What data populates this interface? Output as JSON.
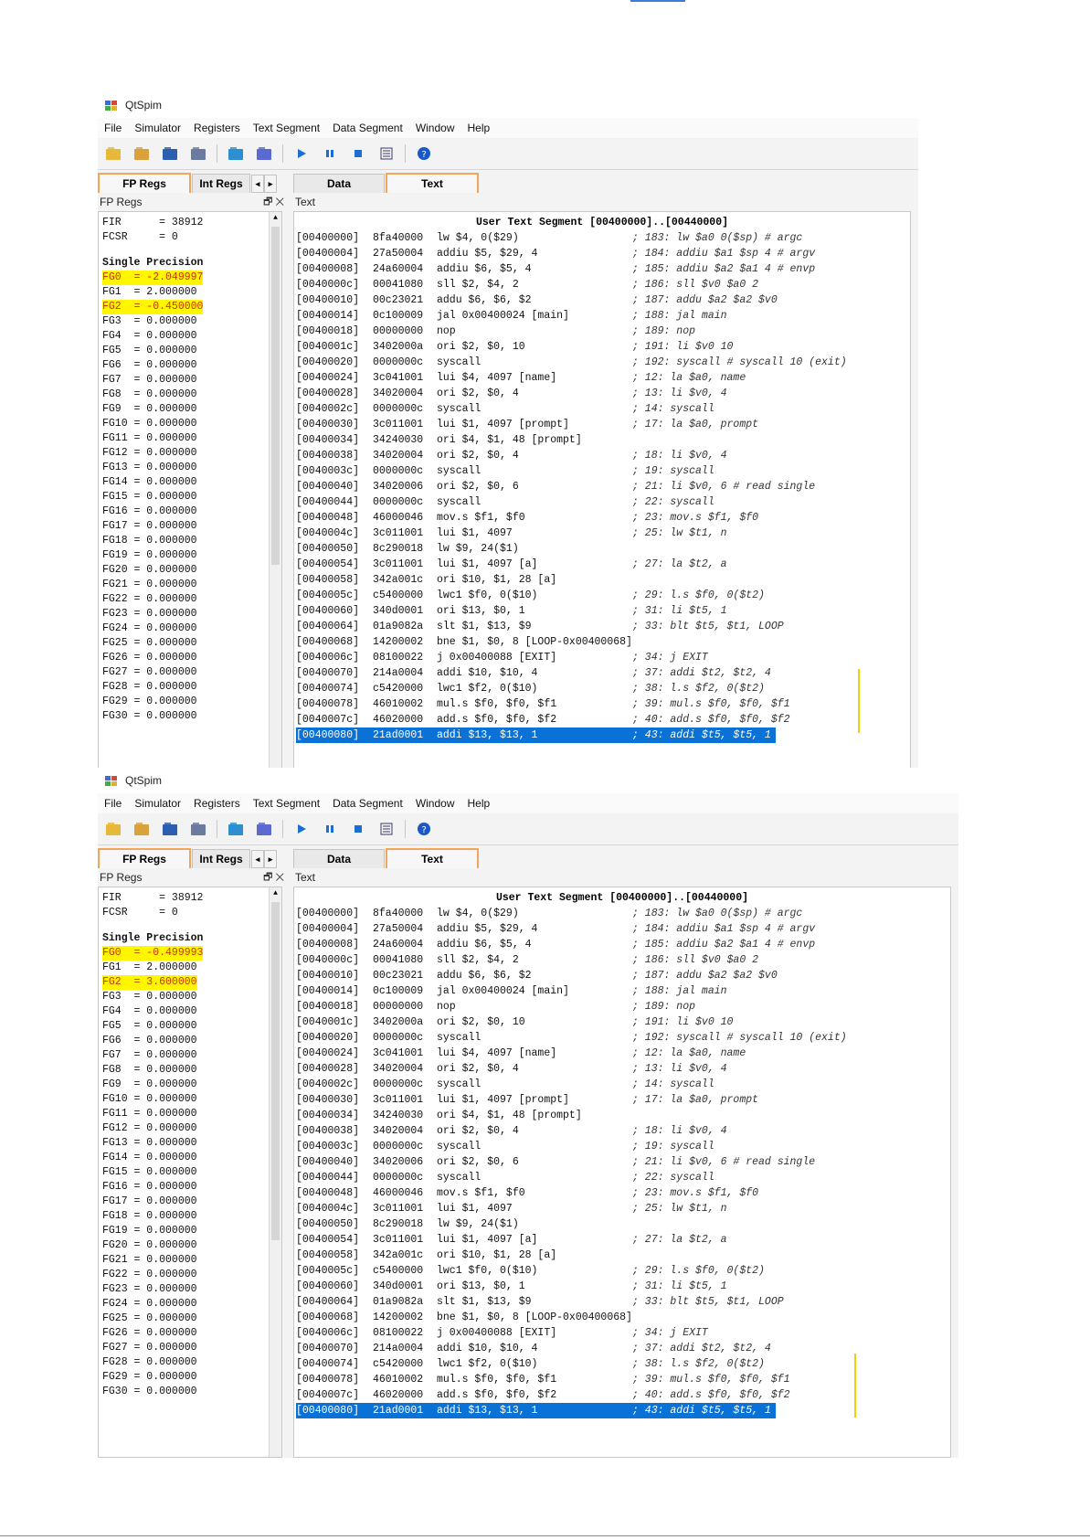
{
  "windows": [
    {
      "app_title": "QtSpim",
      "menu": [
        "File",
        "Simulator",
        "Registers",
        "Text Segment",
        "Data Segment",
        "Window",
        "Help"
      ],
      "left_tabs": [
        "FP Regs",
        "Int Regs"
      ],
      "right_tabs": [
        "Data",
        "Text"
      ],
      "left_dock_title": "FP Regs",
      "right_dock_title": "Text",
      "fir": "FIR      = 38912",
      "fcsr": "FCSR     = 0",
      "single_header": "Single Precision",
      "regs": [
        "FG0  = -2.049997",
        "FG1  = 2.000000",
        "FG2  = -0.450000",
        "FG3  = 0.000000",
        "FG4  = 0.000000",
        "FG5  = 0.000000",
        "FG6  = 0.000000",
        "FG7  = 0.000000",
        "FG8  = 0.000000",
        "FG9  = 0.000000",
        "FG10 = 0.000000",
        "FG11 = 0.000000",
        "FG12 = 0.000000",
        "FG13 = 0.000000",
        "FG14 = 0.000000",
        "FG15 = 0.000000",
        "FG16 = 0.000000",
        "FG17 = 0.000000",
        "FG18 = 0.000000",
        "FG19 = 0.000000",
        "FG20 = 0.000000",
        "FG21 = 0.000000",
        "FG22 = 0.000000",
        "FG23 = 0.000000",
        "FG24 = 0.000000",
        "FG25 = 0.000000",
        "FG26 = 0.000000",
        "FG27 = 0.000000",
        "FG28 = 0.000000",
        "FG29 = 0.000000",
        "FG30 = 0.000000"
      ],
      "highlighted_regs": [
        0,
        2
      ]
    },
    {
      "app_title": "QtSpim",
      "menu": [
        "File",
        "Simulator",
        "Registers",
        "Text Segment",
        "Data Segment",
        "Window",
        "Help"
      ],
      "left_tabs": [
        "FP Regs",
        "Int Regs"
      ],
      "right_tabs": [
        "Data",
        "Text"
      ],
      "left_dock_title": "FP Regs",
      "right_dock_title": "Text",
      "fir": "FIR      = 38912",
      "fcsr": "FCSR     = 0",
      "single_header": "Single Precision",
      "regs": [
        "FG0  = -0.499993",
        "FG1  = 2.000000",
        "FG2  = 3.600000",
        "FG3  = 0.000000",
        "FG4  = 0.000000",
        "FG5  = 0.000000",
        "FG6  = 0.000000",
        "FG7  = 0.000000",
        "FG8  = 0.000000",
        "FG9  = 0.000000",
        "FG10 = 0.000000",
        "FG11 = 0.000000",
        "FG12 = 0.000000",
        "FG13 = 0.000000",
        "FG14 = 0.000000",
        "FG15 = 0.000000",
        "FG16 = 0.000000",
        "FG17 = 0.000000",
        "FG18 = 0.000000",
        "FG19 = 0.000000",
        "FG20 = 0.000000",
        "FG21 = 0.000000",
        "FG22 = 0.000000",
        "FG23 = 0.000000",
        "FG24 = 0.000000",
        "FG25 = 0.000000",
        "FG26 = 0.000000",
        "FG27 = 0.000000",
        "FG28 = 0.000000",
        "FG29 = 0.000000",
        "FG30 = 0.000000"
      ],
      "highlighted_regs": [
        0,
        2
      ]
    }
  ],
  "segment_header": "User Text Segment [00400000]..[00440000]",
  "code": [
    {
      "addr": "[00400000]",
      "hex": "8fa40000",
      "ins": "lw $4, 0($29)",
      "cmt": "; 183: lw $a0 0($sp) # argc"
    },
    {
      "addr": "[00400004]",
      "hex": "27a50004",
      "ins": "addiu $5, $29, 4",
      "cmt": "; 184: addiu $a1 $sp 4 # argv"
    },
    {
      "addr": "[00400008]",
      "hex": "24a60004",
      "ins": "addiu $6, $5, 4",
      "cmt": "; 185: addiu $a2 $a1 4 # envp"
    },
    {
      "addr": "[0040000c]",
      "hex": "00041080",
      "ins": "sll $2, $4, 2",
      "cmt": "; 186: sll $v0 $a0 2"
    },
    {
      "addr": "[00400010]",
      "hex": "00c23021",
      "ins": "addu $6, $6, $2",
      "cmt": "; 187: addu $a2 $a2 $v0"
    },
    {
      "addr": "[00400014]",
      "hex": "0c100009",
      "ins": "jal 0x00400024 [main]",
      "cmt": "; 188: jal main"
    },
    {
      "addr": "[00400018]",
      "hex": "00000000",
      "ins": "nop",
      "cmt": "; 189: nop"
    },
    {
      "addr": "[0040001c]",
      "hex": "3402000a",
      "ins": "ori $2, $0, 10",
      "cmt": "; 191: li $v0 10"
    },
    {
      "addr": "[00400020]",
      "hex": "0000000c",
      "ins": "syscall",
      "cmt": "; 192: syscall # syscall 10 (exit)"
    },
    {
      "addr": "[00400024]",
      "hex": "3c041001",
      "ins": "lui $4, 4097 [name]",
      "cmt": "; 12: la $a0, name"
    },
    {
      "addr": "[00400028]",
      "hex": "34020004",
      "ins": "ori $2, $0, 4",
      "cmt": "; 13: li $v0, 4"
    },
    {
      "addr": "[0040002c]",
      "hex": "0000000c",
      "ins": "syscall",
      "cmt": "; 14: syscall"
    },
    {
      "addr": "[00400030]",
      "hex": "3c011001",
      "ins": "lui $1, 4097 [prompt]",
      "cmt": "; 17: la $a0, prompt"
    },
    {
      "addr": "[00400034]",
      "hex": "34240030",
      "ins": "ori $4, $1, 48 [prompt]",
      "cmt": ""
    },
    {
      "addr": "[00400038]",
      "hex": "34020004",
      "ins": "ori $2, $0, 4",
      "cmt": "; 18: li $v0, 4"
    },
    {
      "addr": "[0040003c]",
      "hex": "0000000c",
      "ins": "syscall",
      "cmt": "; 19: syscall"
    },
    {
      "addr": "[00400040]",
      "hex": "34020006",
      "ins": "ori $2, $0, 6",
      "cmt": "; 21: li $v0, 6 # read single"
    },
    {
      "addr": "[00400044]",
      "hex": "0000000c",
      "ins": "syscall",
      "cmt": "; 22: syscall"
    },
    {
      "addr": "[00400048]",
      "hex": "46000046",
      "ins": "mov.s $f1, $f0",
      "cmt": "; 23: mov.s $f1, $f0"
    },
    {
      "addr": "[0040004c]",
      "hex": "3c011001",
      "ins": "lui $1, 4097",
      "cmt": "; 25: lw $t1, n"
    },
    {
      "addr": "[00400050]",
      "hex": "8c290018",
      "ins": "lw $9, 24($1)",
      "cmt": ""
    },
    {
      "addr": "[00400054]",
      "hex": "3c011001",
      "ins": "lui $1, 4097 [a]",
      "cmt": "; 27: la $t2, a"
    },
    {
      "addr": "[00400058]",
      "hex": "342a001c",
      "ins": "ori $10, $1, 28 [a]",
      "cmt": ""
    },
    {
      "addr": "[0040005c]",
      "hex": "c5400000",
      "ins": "lwc1 $f0, 0($10)",
      "cmt": "; 29: l.s $f0, 0($t2)"
    },
    {
      "addr": "[00400060]",
      "hex": "340d0001",
      "ins": "ori $13, $0, 1",
      "cmt": "; 31: li $t5, 1"
    },
    {
      "addr": "[00400064]",
      "hex": "01a9082a",
      "ins": "slt $1, $13, $9",
      "cmt": "; 33: blt $t5, $t1, LOOP"
    },
    {
      "addr": "[00400068]",
      "hex": "14200002",
      "ins": "bne $1, $0, 8 [LOOP-0x00400068]",
      "cmt": ""
    },
    {
      "addr": "[0040006c]",
      "hex": "08100022",
      "ins": "j 0x00400088 [EXIT]",
      "cmt": "; 34: j EXIT"
    },
    {
      "addr": "[00400070]",
      "hex": "214a0004",
      "ins": "addi $10, $10, 4",
      "cmt": "; 37: addi $t2, $t2, 4"
    },
    {
      "addr": "[00400074]",
      "hex": "c5420000",
      "ins": "lwc1 $f2, 0($10)",
      "cmt": "; 38: l.s $f2, 0($t2)"
    },
    {
      "addr": "[00400078]",
      "hex": "46010002",
      "ins": "mul.s $f0, $f0, $f1",
      "cmt": "; 39: mul.s $f0, $f0, $f1"
    },
    {
      "addr": "[0040007c]",
      "hex": "46020000",
      "ins": "add.s $f0, $f0, $f2",
      "cmt": "; 40: add.s $f0, $f0, $f2"
    },
    {
      "addr": "[00400080]",
      "hex": "21ad0001",
      "ins": "addi $13, $13, 1",
      "cmt": "; 43: addi $t5, $t5, 1"
    }
  ],
  "current_line": 32,
  "colors": {
    "highlight_blue": "#0a72d6",
    "reg_highlight": "#fff600",
    "tab_orange": "#f2a65a",
    "annotation": "#f5d000"
  }
}
